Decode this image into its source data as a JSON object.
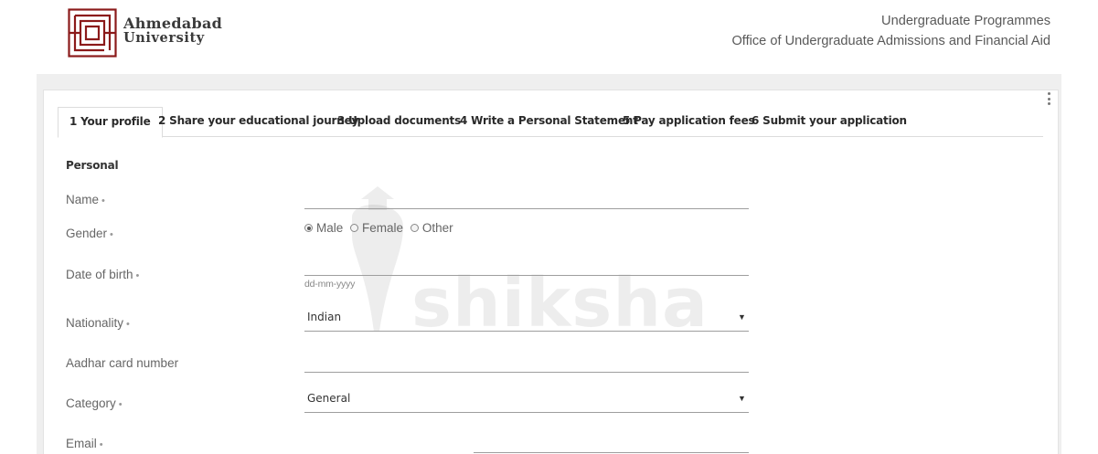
{
  "header": {
    "logo_line1": "Ahmedabad",
    "logo_line2": "University",
    "right_line1": "Undergraduate Programmes",
    "right_line2": "Office of Undergraduate Admissions and Financial Aid"
  },
  "tabs": [
    {
      "label": "1 Your profile",
      "active": true
    },
    {
      "label": "2 Share your educational journey",
      "active": false
    },
    {
      "label": "3 Upload documents",
      "active": false
    },
    {
      "label": "4 Write a Personal Statement",
      "active": false
    },
    {
      "label": "5 Pay application fees",
      "active": false
    },
    {
      "label": "6 Submit your application",
      "active": false
    }
  ],
  "section": {
    "title": "Personal"
  },
  "fields": {
    "name": {
      "label": "Name",
      "value": ""
    },
    "gender": {
      "label": "Gender",
      "options": [
        "Male",
        "Female",
        "Other"
      ],
      "selected": "Male"
    },
    "dob": {
      "label": "Date of birth",
      "hint": "dd-mm-yyyy",
      "value": ""
    },
    "nationality": {
      "label": "Nationality",
      "value": "Indian"
    },
    "aadhar": {
      "label": "Aadhar card number",
      "value": ""
    },
    "category": {
      "label": "Category",
      "value": "General"
    },
    "email": {
      "label": "Email",
      "value": ""
    }
  },
  "required_mark": "•",
  "watermark": {
    "text": "shiksha"
  },
  "colors": {
    "brand": "#8b1a1a",
    "band": "#efefef"
  }
}
